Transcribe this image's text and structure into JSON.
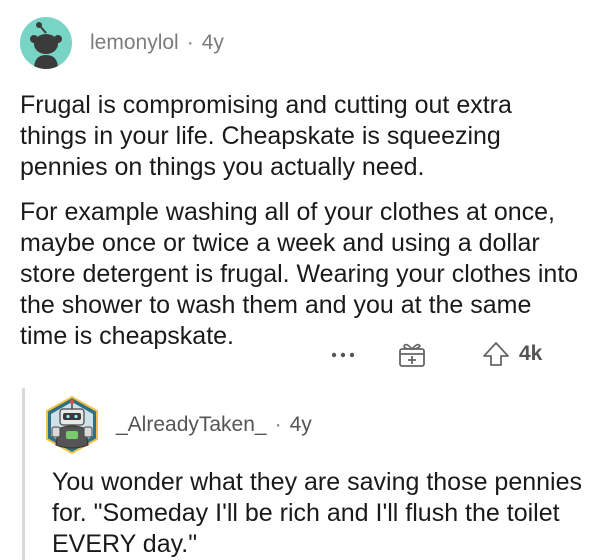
{
  "top_comment": {
    "username": "lemonylol",
    "separator": "·",
    "age": "4y",
    "paragraphs": [
      "Frugal is compromising and cutting out extra things in your life. Cheapskate is squeezing pennies on things you actually need.",
      "For example washing all of your clothes at once, maybe once or twice a week and using a dollar store detergent is frugal. Wearing your clothes into the shower to wash them and you at the same time is cheapskate."
    ],
    "avatar_color": "#78d4c4"
  },
  "actions": {
    "more_icon": "more-dots-icon",
    "award_icon": "gift-award-icon",
    "upvote_icon": "upvote-arrow-icon",
    "vote_count": "4k"
  },
  "reply": {
    "username": "_AlreadyTaken_",
    "separator": "·",
    "age": "4y",
    "text": "You wonder what they are saving those pennies for.  \"Someday I'll be rich and I'll flush the toilet EVERY day.\""
  }
}
